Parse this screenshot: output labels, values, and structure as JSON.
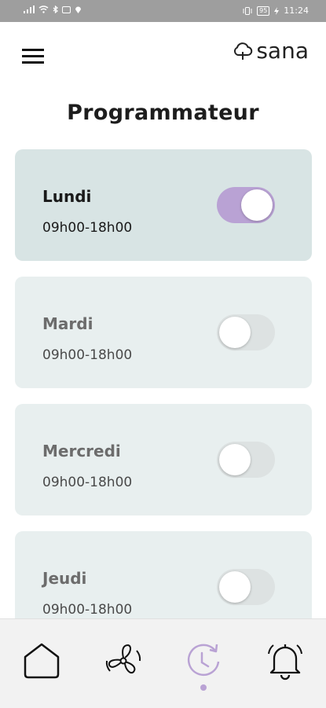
{
  "status_bar": {
    "battery": "95",
    "time": "11:24"
  },
  "header": {
    "logo_text": "sana",
    "menu_icon": "hamburger-menu-icon",
    "logo_icon": "cloud-tree-icon"
  },
  "page": {
    "title": "Programmateur"
  },
  "schedule": [
    {
      "day": "Lundi",
      "time": "09h00-18h00",
      "enabled": true
    },
    {
      "day": "Mardi",
      "time": "09h00-18h00",
      "enabled": false
    },
    {
      "day": "Mercredi",
      "time": "09h00-18h00",
      "enabled": false
    },
    {
      "day": "Jeudi",
      "time": "09h00-18h00",
      "enabled": false
    }
  ],
  "bottom_nav": {
    "items": [
      {
        "icon": "home-icon",
        "active": false
      },
      {
        "icon": "fan-icon",
        "active": false
      },
      {
        "icon": "schedule-clock-icon",
        "active": true
      },
      {
        "icon": "bell-icon",
        "active": false
      }
    ]
  },
  "colors": {
    "accent": "#b9a2d4",
    "card_active": "#d8e4e4",
    "card_inactive": "#e8efef",
    "toggle_off": "#dde2e2",
    "status_bar": "#9e9e9e"
  }
}
